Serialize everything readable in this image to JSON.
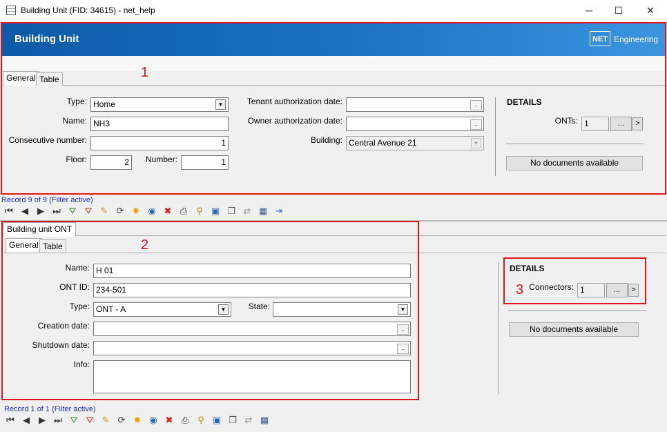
{
  "window": {
    "title": "Building Unit (FID: 34615) - net_help",
    "minimize": "─",
    "maximize": "☐",
    "close": "✕"
  },
  "header": {
    "title": "Building Unit",
    "logo_mark": "NET",
    "logo_text": "Engineering"
  },
  "annotations": {
    "n1": "1",
    "n2": "2",
    "n3": "3"
  },
  "top": {
    "tabs": [
      "General",
      "Table"
    ],
    "fields": {
      "type_label": "Type:",
      "type_value": "Home",
      "name_label": "Name:",
      "name_value": "NH3",
      "consecutive_label": "Consecutive number:",
      "consecutive_value": "1",
      "floor_label": "Floor:",
      "floor_value": "2",
      "number_label": "Number:",
      "number_value": "1",
      "tenant_label": "Tenant authorization date:",
      "tenant_value": "",
      "owner_label": "Owner authorization date:",
      "owner_value": "",
      "building_label": "Building:",
      "building_value": "Central Avenue 21"
    },
    "details": {
      "title": "DETAILS",
      "onts_label": "ONTs:",
      "onts_value": "1",
      "dots": "...",
      "arrow": ">",
      "documents": "No documents available"
    },
    "record": "Record 9 of 9 (Filter active)"
  },
  "bottom": {
    "outer_tab": "Building unit ONT",
    "tabs": [
      "General",
      "Table"
    ],
    "fields": {
      "name_label": "Name:",
      "name_value": "H 01",
      "ontid_label": "ONT ID:",
      "ontid_value": "234-501",
      "type_label": "Type:",
      "type_value": "ONT - A",
      "state_label": "State:",
      "state_value": "",
      "creation_label": "Creation date:",
      "creation_value": "",
      "shutdown_label": "Shutdown date:",
      "shutdown_value": "",
      "info_label": "Info:",
      "info_value": ""
    },
    "details": {
      "title": "DETAILS",
      "connectors_label": "Connectors:",
      "connectors_value": "1",
      "dots": "...",
      "arrow": ">",
      "documents": "No documents available"
    },
    "record": "Record 1 of 1 (Filter active)"
  },
  "toolbar_icons": [
    {
      "name": "first-record-icon",
      "glyph": "⏮",
      "color": "#333"
    },
    {
      "name": "previous-record-icon",
      "glyph": "◀",
      "color": "#333"
    },
    {
      "name": "next-record-icon",
      "glyph": "▶",
      "color": "#333"
    },
    {
      "name": "last-record-icon",
      "glyph": "⏭",
      "color": "#333"
    },
    {
      "name": "add-filter-icon",
      "glyph": "⛛",
      "color": "#2a8a2a"
    },
    {
      "name": "remove-filter-icon",
      "glyph": "⛛",
      "color": "#c0302a"
    },
    {
      "name": "edit-pencil-icon",
      "glyph": "✎",
      "color": "#d08a10"
    },
    {
      "name": "refresh-icon",
      "glyph": "⟳",
      "color": "#333"
    },
    {
      "name": "new-record-icon",
      "glyph": "✸",
      "color": "#e8a400"
    },
    {
      "name": "globe-icon",
      "glyph": "◉",
      "color": "#2a6ab0"
    },
    {
      "name": "delete-icon",
      "glyph": "✖",
      "color": "#d42020"
    },
    {
      "name": "print-icon",
      "glyph": "⎙",
      "color": "#333"
    },
    {
      "name": "zoom-icon",
      "glyph": "⚲",
      "color": "#c08010"
    },
    {
      "name": "select-icon",
      "glyph": "▣",
      "color": "#2a6ab0"
    },
    {
      "name": "copy-icon",
      "glyph": "❐",
      "color": "#555"
    },
    {
      "name": "move-icon",
      "glyph": "⇄",
      "color": "#999"
    },
    {
      "name": "table-edit-icon",
      "glyph": "▦",
      "color": "#3a5a8a"
    },
    {
      "name": "exit-icon",
      "glyph": "⇥",
      "color": "#2a6ab0"
    }
  ]
}
